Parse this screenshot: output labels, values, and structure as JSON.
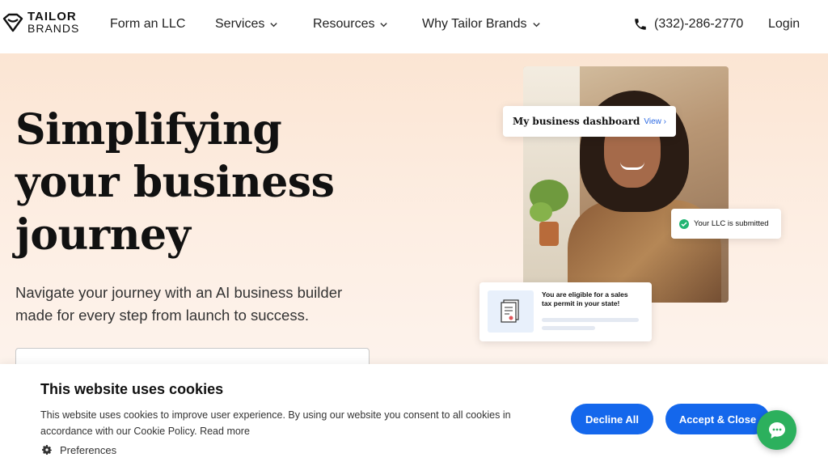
{
  "brand": {
    "line1": "TAILOR",
    "line2": "BRANDS"
  },
  "nav": {
    "items": [
      {
        "label": "Form an LLC",
        "dropdown": false
      },
      {
        "label": "Services",
        "dropdown": true
      },
      {
        "label": "Resources",
        "dropdown": true
      },
      {
        "label": "Why Tailor Brands",
        "dropdown": true
      }
    ],
    "phone": "(332)-286-2770",
    "login": "Login"
  },
  "hero": {
    "title": "Simplifying your business journey",
    "subtitle": "Navigate your journey with an AI business builder made for every step from launch to success.",
    "input_placeholder": ""
  },
  "visual": {
    "dashboard_card": {
      "title": "My business dashboard",
      "link": "View ›"
    },
    "llc_card": {
      "text": "Your LLC is submitted"
    },
    "tax_card": {
      "text": "You are eligible for a sales tax permit in your state!"
    }
  },
  "cookie": {
    "title": "This website uses cookies",
    "text": "This website uses cookies to improve user experience. By using our website you consent to all cookies in accordance with our Cookie Policy. Read more",
    "preferences": "Preferences",
    "decline": "Decline All",
    "accept": "Accept & Close"
  },
  "colors": {
    "accent": "#1467ec",
    "chat": "#2cb05d",
    "hero_bg": "#fbe5d3"
  }
}
